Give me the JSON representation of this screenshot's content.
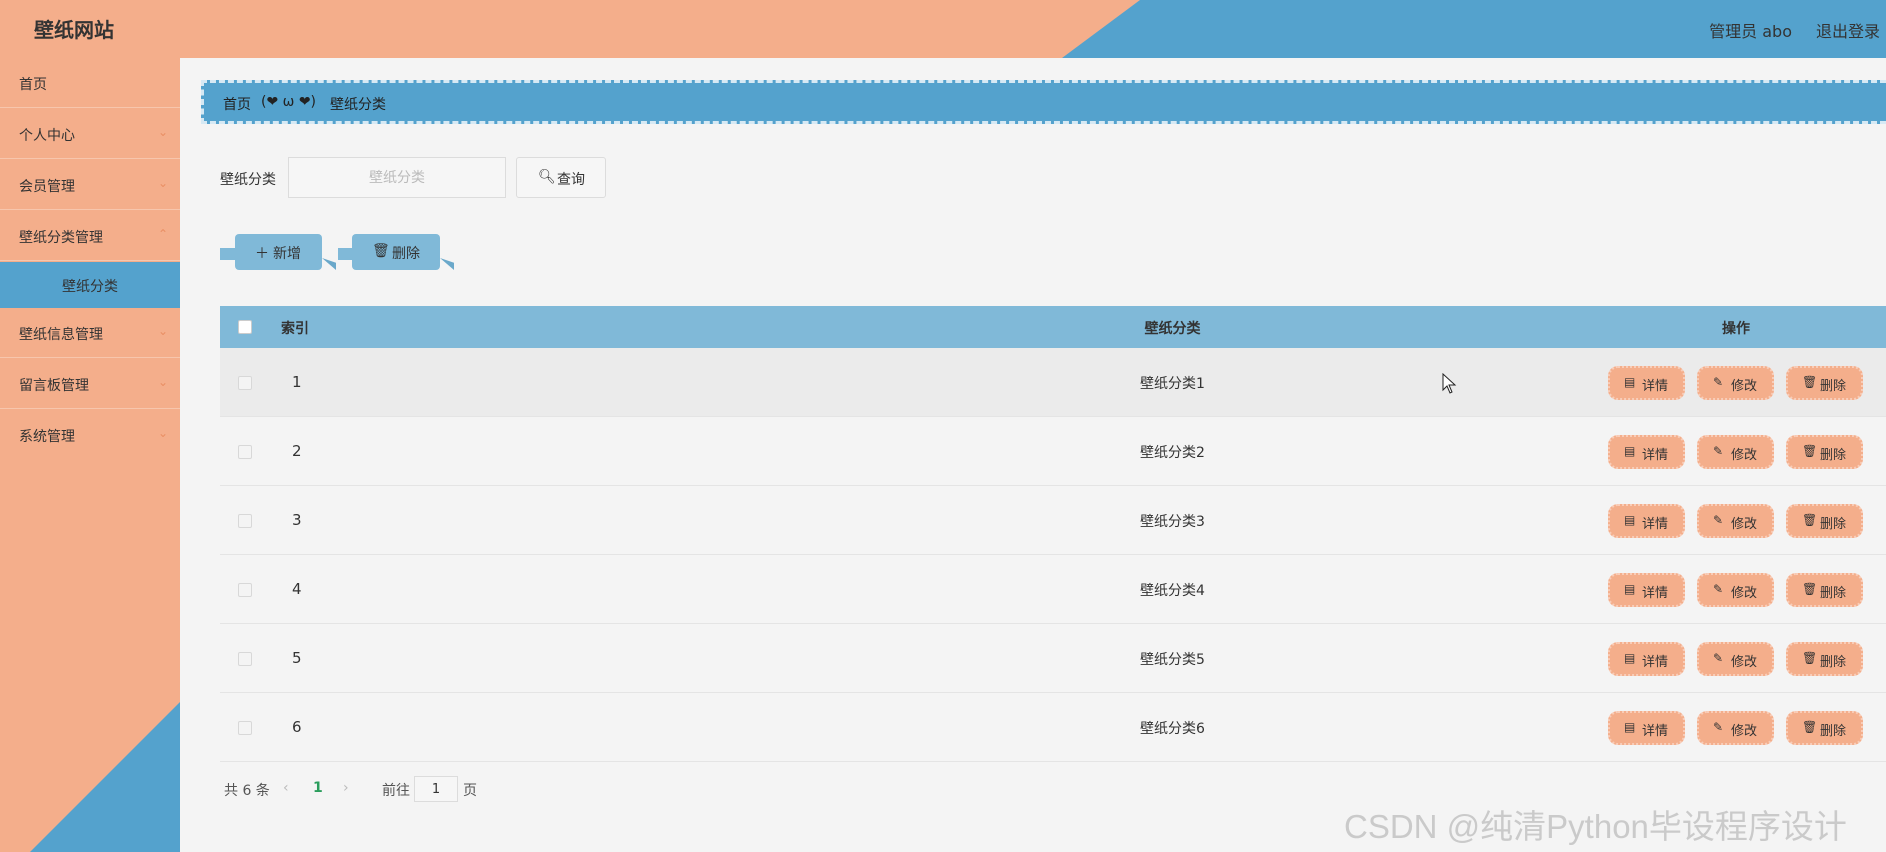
{
  "header": {
    "title": "壁纸网站",
    "admin": "管理员 abo",
    "logout": "退出登录"
  },
  "sidebar": {
    "items": [
      {
        "label": "首页"
      },
      {
        "label": "个人中心"
      },
      {
        "label": "会员管理"
      },
      {
        "label": "壁纸分类管理"
      },
      {
        "label": "壁纸分类"
      },
      {
        "label": "壁纸信息管理"
      },
      {
        "label": "留言板管理"
      },
      {
        "label": "系统管理"
      }
    ]
  },
  "breadcrumb": {
    "home": "首页",
    "separator": "(❤ ω ❤)",
    "current": "壁纸分类"
  },
  "search": {
    "label": "壁纸分类",
    "placeholder": "壁纸分类",
    "button": "查询"
  },
  "actions": {
    "add": "新增",
    "delete": "删除"
  },
  "table": {
    "headers": {
      "index": "索引",
      "category": "壁纸分类",
      "ops": "操作"
    },
    "rows": [
      {
        "index": "1",
        "category": "壁纸分类1"
      },
      {
        "index": "2",
        "category": "壁纸分类2"
      },
      {
        "index": "3",
        "category": "壁纸分类3"
      },
      {
        "index": "4",
        "category": "壁纸分类4"
      },
      {
        "index": "5",
        "category": "壁纸分类5"
      },
      {
        "index": "6",
        "category": "壁纸分类6"
      }
    ],
    "row_ops": {
      "detail": "详情",
      "edit": "修改",
      "delete": "删除"
    }
  },
  "pagination": {
    "total": "共 6 条",
    "current_page": "1",
    "goto_label": "前往",
    "goto_value": "1",
    "page_suffix": "页"
  },
  "watermark": "CSDN @纯清Python毕设程序设计",
  "colors": {
    "peach": "#f4ae8b",
    "blue": "#54a2cd",
    "light_blue": "#80b9d8"
  }
}
